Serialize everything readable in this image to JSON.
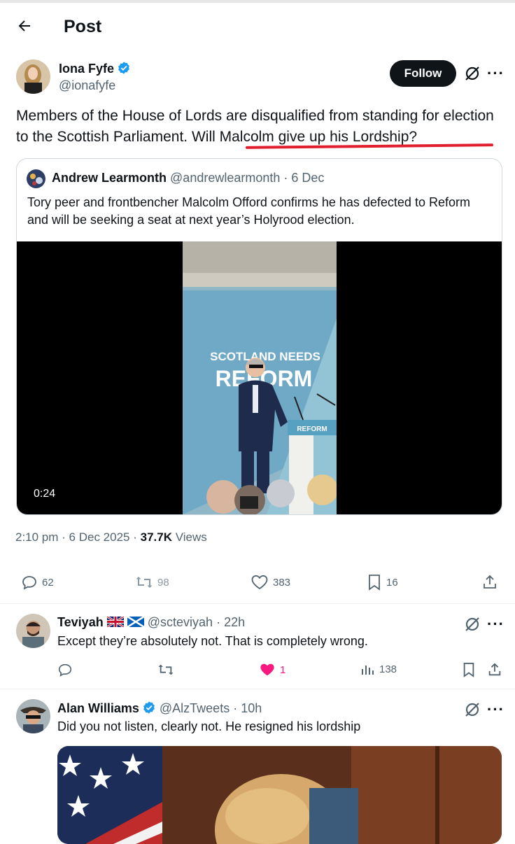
{
  "header": {
    "title": "Post"
  },
  "post": {
    "author_name": "Iona Fyfe",
    "author_handle": "@ionafyfe",
    "follow_label": "Follow",
    "text": "Members of the House of Lords are disqualified from standing for election to the Scottish Parliament. Will Malcolm give up his Lordship?",
    "quote": {
      "author_name": "Andrew Learmonth",
      "author_handle": "@andrewlearmonth",
      "date": "· 6 Dec",
      "text": "Tory peer and frontbencher Malcolm Offord confirms he has defected to Reform and will be seeking a seat at next year’s Holyrood election.",
      "video": {
        "duration": "0:24",
        "banner_line1": "SCOTLAND NEEDS",
        "banner_line2": "REFORM",
        "podium_label": "REFORM"
      }
    },
    "time": "2:10 pm · 6 Dec 2025 ·",
    "views_count": "37.7K",
    "views_label": "Views",
    "actions": {
      "replies": "62",
      "reposts": "98",
      "likes": "383",
      "bookmarks": "16"
    }
  },
  "replies": [
    {
      "name": "Teviyah",
      "handle": "@scteviyah",
      "time": "· 22h",
      "text": "Except they’re absolutely not.  That is completely wrong.",
      "likes": "1",
      "views": "138"
    },
    {
      "name": "Alan Williams",
      "handle": "@AlzTweets",
      "time": "· 10h",
      "text": "Did you not listen, clearly not. He resigned his lordship"
    }
  ],
  "colors": {
    "verified": "#1d9bf0",
    "like_active": "#f91880",
    "underline": "#e01e2e",
    "muted": "#536471"
  },
  "icons": {
    "back": "arrow-left-icon",
    "verified": "verified-badge-icon",
    "grok": "grok-icon",
    "more": "more-icon",
    "reply": "reply-icon",
    "repost": "repost-icon",
    "like": "heart-icon",
    "bookmark": "bookmark-icon",
    "share": "share-icon",
    "views": "views-icon"
  }
}
